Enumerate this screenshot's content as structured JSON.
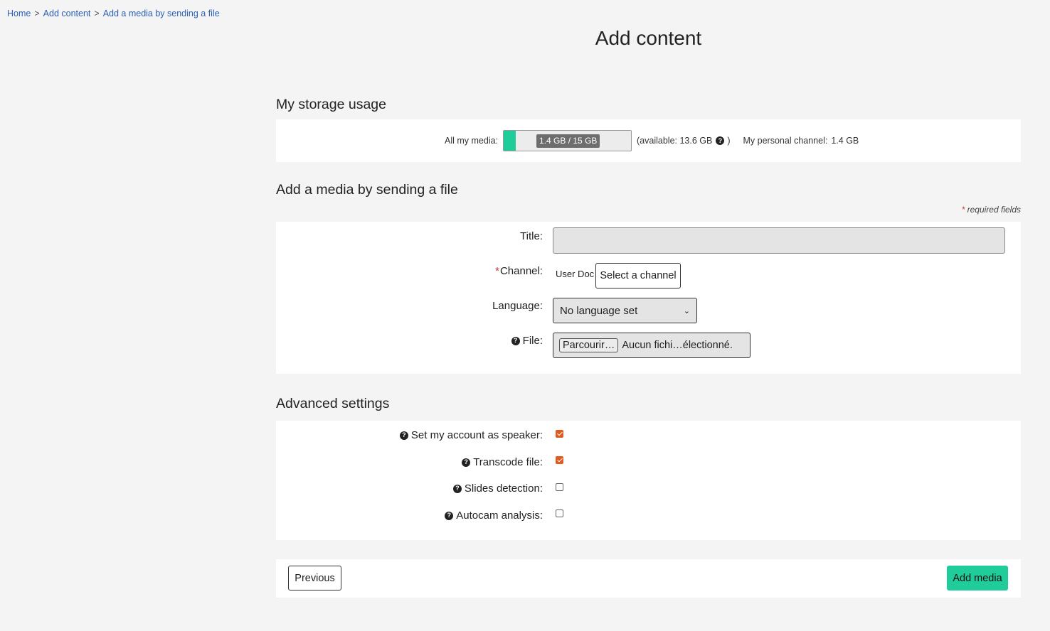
{
  "breadcrumb": {
    "items": [
      "Home",
      "Add content",
      "Add a media by sending a file"
    ],
    "separator": ">"
  },
  "page_title": "Add content",
  "storage": {
    "heading": "My storage usage",
    "all_media_label": "All my media:",
    "usage_text": "1.4 GB / 15 GB",
    "usage_fraction": 0.093,
    "available_text": "(available: 13.6 GB",
    "available_close": ")",
    "personal_label": "My personal channel:",
    "personal_value": "1.4 GB",
    "bar_color": "#1fcc9a"
  },
  "upload": {
    "heading": "Add a media by sending a file",
    "required_star": "*",
    "required_note": "required fields",
    "title_label": "Title:",
    "title_value": "",
    "channel_required_star": "*",
    "channel_label": "Channel:",
    "channel_user": "User Doc",
    "select_channel_button": "Select a channel",
    "language_label": "Language:",
    "language_value": "No language set",
    "file_label": "File:",
    "browse_button": "Parcourir…",
    "file_status": "Aucun fichi…électionné."
  },
  "advanced": {
    "heading": "Advanced settings",
    "options": [
      {
        "label": "Set my account as speaker:",
        "checked": true
      },
      {
        "label": "Transcode file:",
        "checked": true
      },
      {
        "label": "Slides detection:",
        "checked": false
      },
      {
        "label": "Autocam analysis:",
        "checked": false
      }
    ],
    "check_color": "#e05a1f"
  },
  "footer": {
    "previous_button": "Previous",
    "add_button": "Add media",
    "add_button_color": "#1fcc9a"
  }
}
